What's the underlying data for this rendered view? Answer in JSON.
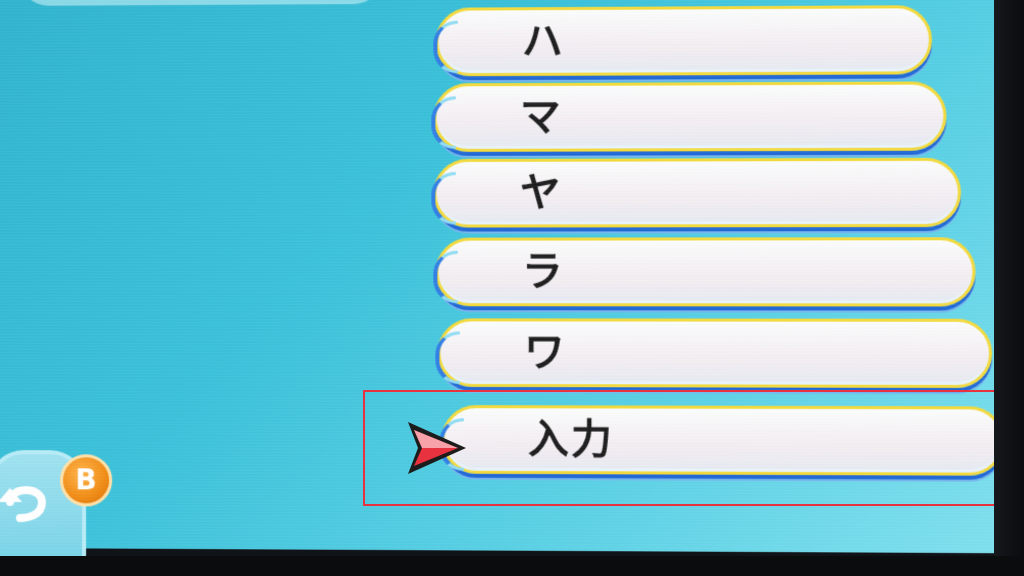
{
  "menu": {
    "items": [
      {
        "label": "ハ"
      },
      {
        "label": "マ"
      },
      {
        "label": "ヤ"
      },
      {
        "label": "ラ"
      },
      {
        "label": "ワ"
      },
      {
        "label": "入力"
      }
    ],
    "selected_index": 5
  },
  "back_button": {
    "badge_label": "B",
    "icon": "return-arrow-icon"
  },
  "cursor": {
    "icon": "pointer-triangle-icon"
  },
  "colors": {
    "background": "#39c1da",
    "entry_border": "#f3da3c",
    "entry_shadow": "#1f67d6",
    "selection_box": "#e8323f",
    "cursor_fill": "#e8323f",
    "badge": "#f08a12"
  }
}
